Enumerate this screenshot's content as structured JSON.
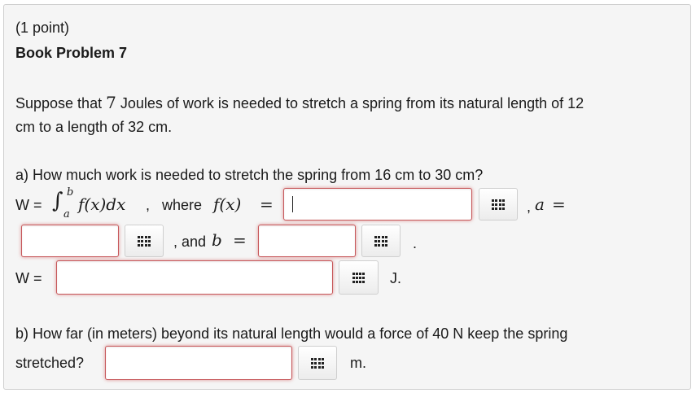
{
  "problem": {
    "points": "(1 point)",
    "title": "Book Problem 7"
  },
  "intro": {
    "part1": "Suppose that",
    "work_value": "7",
    "part2": "Joules of work is needed to stretch a spring from its natural length of 12",
    "line2": "cm to a length of 32 cm."
  },
  "part_a": {
    "question": "a) How much work is needed to stretch the spring from 16 cm to 30 cm?",
    "w_label": "W =",
    "integral_sign": "∫",
    "upper_limit": "b",
    "lower_limit": "a",
    "integrand": "f(x)dx",
    "comma1": ",",
    "where_text": "where",
    "fx_label": "f(x)",
    "equals": "=",
    "comma_a": ",",
    "a_var": "a",
    "and_text": ", and",
    "b_var": "b",
    "period": ".",
    "w_label2": "W =",
    "unit_j": "J.",
    "inputs": {
      "f_value": "",
      "a_value": "",
      "b_value": "",
      "w_value": ""
    }
  },
  "part_b": {
    "question_line1": "b) How far (in meters) beyond its natural length would a force of 40 N keep the spring",
    "question_line2": "stretched?",
    "unit_m": "m.",
    "inputs": {
      "distance_value": ""
    }
  },
  "colors": {
    "panel_bg": "#f5f5f5",
    "panel_border": "#cfcfcf",
    "input_border_error": "#c7585b",
    "text": "#1a1a1a"
  },
  "icons": {
    "equation_editor": "grid-icon"
  }
}
